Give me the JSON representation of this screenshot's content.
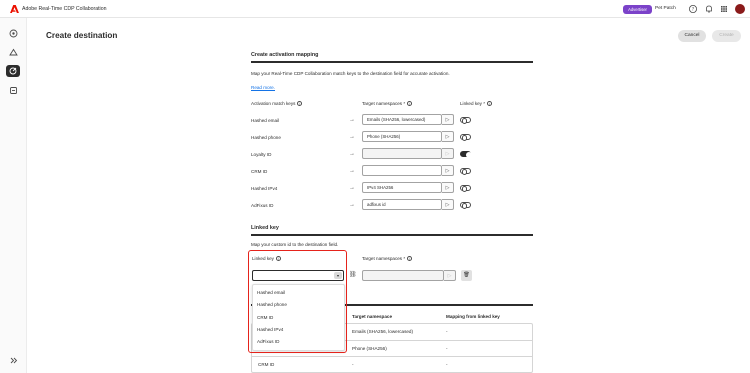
{
  "app": {
    "title": "Adobe Real-Time CDP Collaboration",
    "badge": "Advertiser",
    "org": "Pet Patch"
  },
  "page": {
    "title": "Create destination",
    "cancel_label": "Cancel",
    "create_label": "Create"
  },
  "mapping": {
    "title": "Create activation mapping",
    "description": "Map your Real-Time CDP Collaboration match keys to the destination field for accurate activation.",
    "read_more": "Read more.",
    "col_keys": "Activation match keys",
    "col_target": "Target namespaces",
    "col_linked": "Linked key",
    "rows": [
      {
        "label": "Hashed email",
        "value": "Emails (SHA256, lowercased)",
        "linked": false,
        "enabled": true
      },
      {
        "label": "Hashed phone",
        "value": "Phone (SHA256)",
        "linked": false,
        "enabled": true
      },
      {
        "label": "Loyalty ID",
        "value": "",
        "linked": true,
        "enabled": false
      },
      {
        "label": "CRM ID",
        "value": "",
        "linked": false,
        "enabled": true
      },
      {
        "label": "Hashed IPv4",
        "value": "IPv4 SHA256",
        "linked": false,
        "enabled": true
      },
      {
        "label": "AdFixus ID",
        "value": "adfixus id",
        "linked": false,
        "enabled": true
      }
    ]
  },
  "linked": {
    "title": "Linked key",
    "description": "Map your custom id to the destination field.",
    "label_key": "Linked key",
    "label_target": "Target namespaces",
    "options": [
      "Hashed email",
      "Hashed phone",
      "CRM ID",
      "Hashed IPv4",
      "AdFixus ID"
    ]
  },
  "table": {
    "headers": [
      "Target namespace",
      "Mapping from linked key"
    ],
    "rows": [
      {
        "key": "",
        "target": "Emails (SHA256, lowercased)",
        "mapping": "-"
      },
      {
        "key": "",
        "target": "Phone (SHA256)",
        "mapping": "-"
      },
      {
        "key": "CRM ID",
        "target": "-",
        "mapping": "-"
      }
    ]
  },
  "colors": {
    "accent": "#1473e6",
    "badge": "#7b42c9",
    "highlight": "#e5231b"
  },
  "icons": [
    "adobe-logo-icon",
    "help-icon",
    "bell-icon",
    "apps-grid-icon",
    "home-icon",
    "audiences-icon",
    "destinations-icon",
    "settings-icon",
    "expand-icon",
    "info-icon",
    "arrow-right-icon",
    "send-icon",
    "link-icon",
    "trash-icon",
    "chevron-down-icon"
  ]
}
